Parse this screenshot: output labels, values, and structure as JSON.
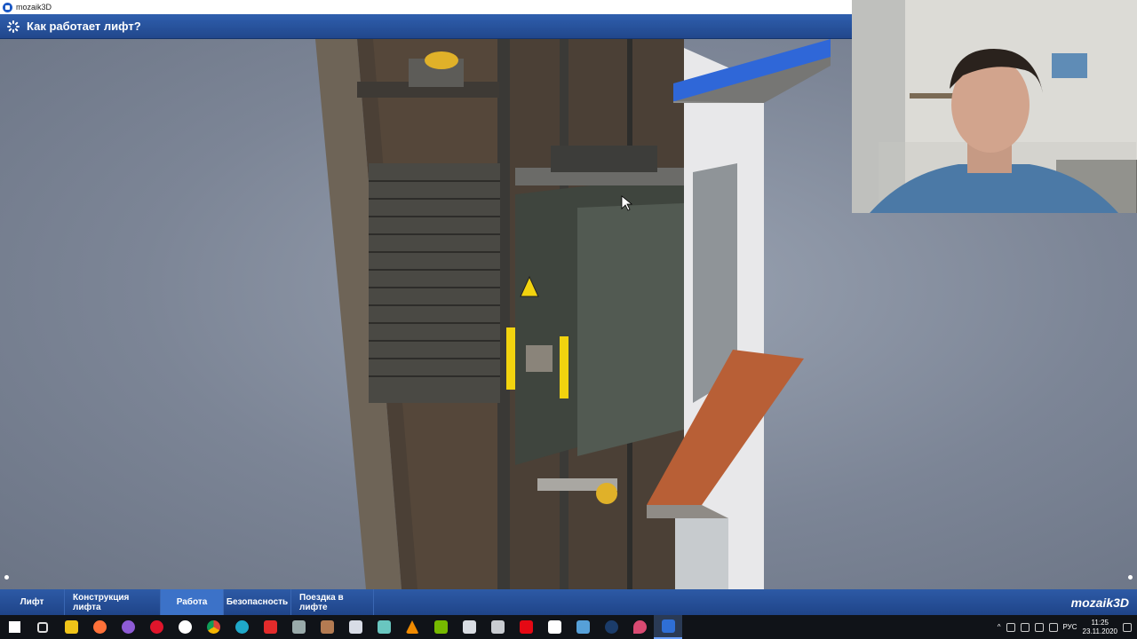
{
  "window": {
    "title": "mozaik3D"
  },
  "app": {
    "title": "Как работает лифт?"
  },
  "nav": {
    "items": [
      "Лифт",
      "Конструкция лифта",
      "Работа",
      "Безопасность",
      "Поездка в лифте"
    ],
    "active_index": 2,
    "brand": "mozaik3D"
  },
  "taskbar": {
    "icons": [
      "windows-start-icon",
      "task-view-icon",
      "file-explorer-icon",
      "firefox-icon",
      "app-icon",
      "opera-icon",
      "yandex-browser-icon",
      "chrome-icon",
      "edge-icon",
      "yandex-icon",
      "app-icon",
      "app-icon",
      "app-icon",
      "app-icon",
      "vlc-icon",
      "nvidia-icon",
      "calculator-icon",
      "camera-icon",
      "netflix-icon",
      "mail-icon",
      "app-icon",
      "steam-icon",
      "app-icon",
      "mozaik-icon"
    ],
    "tray": {
      "lang": "РУС",
      "time": "11:25",
      "date": "23.11.2020"
    }
  },
  "colors": {
    "header_blue": "#2a55a0",
    "active_tab": "#3c72c8",
    "warning_yellow": "#f2d30f"
  }
}
